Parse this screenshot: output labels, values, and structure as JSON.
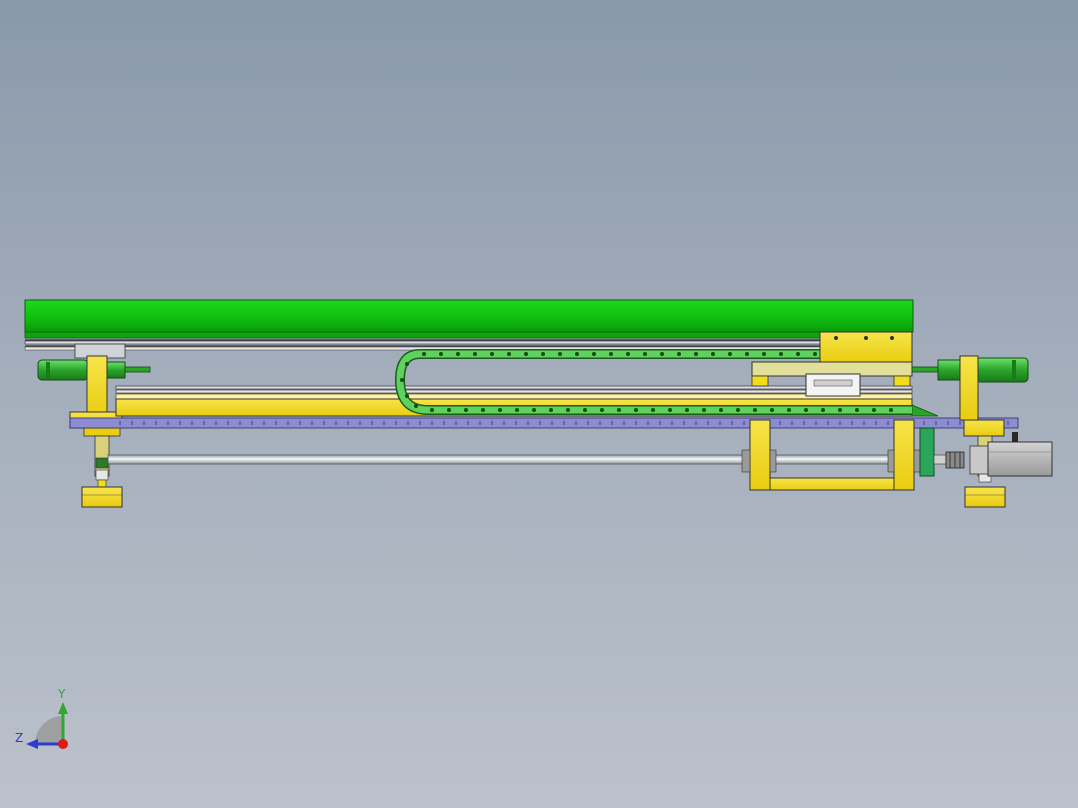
{
  "viewport": {
    "background_top": "#8999ab",
    "background_bottom": "#bcc2cb"
  },
  "colors": {
    "frame_green": "#12c412",
    "chain_green": "#5fd15f",
    "bracket_yellow": "#f2dc1c",
    "base_plate": "#8c8cd0",
    "shaft": "#dfe7ea",
    "motor_gray": "#b9b9b9",
    "outline": "#1a1a1a"
  },
  "triad": {
    "y_label": "Y",
    "z_label": "Z",
    "icon": "orientation-triad-icon"
  }
}
